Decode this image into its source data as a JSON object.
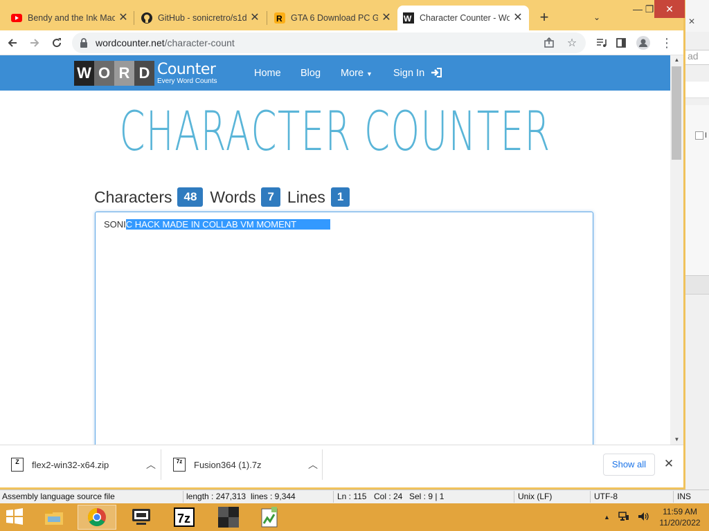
{
  "tabs": [
    {
      "title": "Bendy and the Ink Mac",
      "icon": "youtube-icon",
      "active": false
    },
    {
      "title": "GitHub - sonicretro/s1d",
      "icon": "github-icon",
      "active": false
    },
    {
      "title": "GTA 6 Download PC Ga",
      "icon": "rockstar-icon",
      "active": false
    },
    {
      "title": "Character Counter - Wo",
      "icon": "wordcounter-icon",
      "active": true
    }
  ],
  "address": {
    "host": "wordcounter.net",
    "path": "/character-count"
  },
  "site": {
    "logo_letters": [
      "W",
      "O",
      "R",
      "D"
    ],
    "logo_title": "Counter",
    "logo_tagline": "Every Word Counts",
    "nav": {
      "home": "Home",
      "blog": "Blog",
      "more": "More",
      "signin": "Sign In"
    }
  },
  "page": {
    "title": "CHARACTER COUNTER",
    "stats": {
      "characters_label": "Characters",
      "characters_value": "48",
      "words_label": "Words",
      "words_value": "7",
      "lines_label": "Lines",
      "lines_value": "1"
    },
    "editor": {
      "text_plain": "SONI",
      "text_selected": "C HACK MADE IN COLLAB VM MOMENT"
    }
  },
  "downloads": {
    "items": [
      {
        "name": "flex2-win32-x64.zip",
        "badge": "Z"
      },
      {
        "name": "Fusion364 (1).7z",
        "badge": "7z"
      }
    ],
    "show_all": "Show all"
  },
  "statusbar": {
    "filetype": "Assembly language source file",
    "length": "length : 247,313",
    "lines": "lines : 9,344",
    "ln": "Ln : 115",
    "col": "Col : 24",
    "sel": "Sel : 9 | 1",
    "eol": "Unix (LF)",
    "encoding": "UTF-8",
    "mode": "INS"
  },
  "background_window": {
    "partial_text": "ad",
    "partial_label": "I"
  },
  "taskbar": {
    "apps": [
      "file-explorer-icon",
      "chrome-icon",
      "virtual-machine-icon",
      "7zip-icon",
      "flex-icon",
      "notepadpp-icon"
    ],
    "seven_zip_label": "7z",
    "time": "11:59 AM",
    "date": "11/20/2022"
  },
  "colors": {
    "brand_blue": "#3b8dd4",
    "title_teal": "#5ab5d8",
    "badge_blue": "#2f7bbf",
    "tab_strip": "#f7cf73",
    "taskbar": "#e3a43c"
  }
}
